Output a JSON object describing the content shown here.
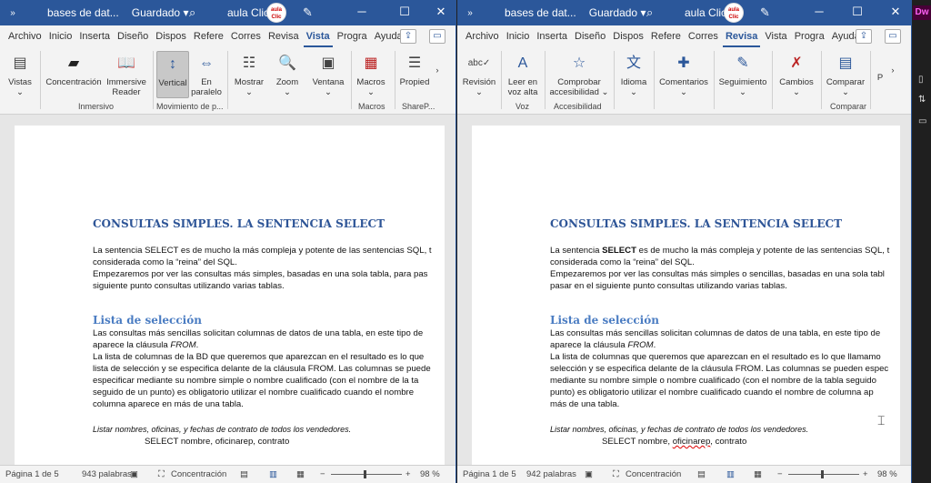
{
  "windows": [
    {
      "title": {
        "doc": "bases de dat...",
        "status": "Guardado ▾",
        "user": "aula Clic",
        "logo": "aula Clic"
      },
      "tabs": [
        "Archivo",
        "Inicio",
        "Inserta",
        "Diseño",
        "Dispos",
        "Refere",
        "Corres",
        "Revisa",
        "Vista",
        "Progra",
        "Ayuda"
      ],
      "active_tab": "Vista",
      "ribbon": {
        "buttons": [
          "Vistas",
          "Concentración",
          "Immersive Reader",
          "Vertical",
          "En paralelo",
          "Mostrar",
          "Zoom",
          "Ventana",
          "Macros",
          "Propied"
        ],
        "groups": [
          "Inmersivo",
          "Movimiento de p...",
          "Macros",
          "ShareP..."
        ]
      },
      "doc": {
        "heading": "CONSULTAS SIMPLES. LA SENTENCIA SELECT",
        "p1_line1": "La sentencia SELECT es de mucho la más compleja y potente de las sentencias SQL, t",
        "p1_line2": "considerada como la “reina” del SQL.",
        "p2_line1": "Empezaremos por ver las consultas más simples, basadas en una sola tabla, para pas",
        "p2_line2": "siguiente punto consultas utilizando varias tablas.",
        "subheading": "Lista de selección",
        "p3_line1": "Las consultas más sencillas solicitan columnas de datos de una tabla, en este tipo de",
        "p3_line2a": "aparece la cláusula ",
        "p3_line2b": "FROM",
        "p3_line2c": ".",
        "p4_line1": "La lista de columnas de la BD que queremos que aparezcan en el resultado es lo que",
        "p4_line2": "lista de selección y se especifica delante de la cláusula FROM. Las columnas se puede",
        "p4_line3": "especificar mediante su nombre simple o nombre cualificado (con el nombre de la ta",
        "p4_line4": "seguido de un punto) es obligatorio utilizar el nombre cualificado cuando el nombre",
        "p4_line5": "columna aparece en más de una tabla.",
        "example": "Listar nombres, oficinas, y fechas de contrato de todos los vendedores.",
        "sql_a": "SELECT nombre, ",
        "sql_b": "oficinarep",
        "sql_c": ", contrato"
      },
      "status": {
        "page": "Página 1 de 5",
        "words": "943 palabras",
        "focus": "Concentración",
        "zoom": "98 %"
      }
    },
    {
      "title": {
        "doc": "bases de dat...",
        "status": "Guardado ▾",
        "user": "aula Clic",
        "logo": "aula Clic"
      },
      "tabs": [
        "Archivo",
        "Inicio",
        "Inserta",
        "Diseño",
        "Dispos",
        "Refere",
        "Corres",
        "Revisa",
        "Vista",
        "Progra",
        "Ayuda"
      ],
      "active_tab": "Revisa",
      "ribbon": {
        "buttons": [
          "Revisión",
          "Leer en voz alta",
          "Comprobar accesibilidad",
          "Idioma",
          "Comentarios",
          "Seguimiento",
          "Cambios",
          "Comparar",
          "P"
        ],
        "groups": [
          "Voz",
          "Accesibilidad",
          "Comparar"
        ]
      },
      "doc": {
        "heading": "CONSULTAS SIMPLES. LA SENTENCIA SELECT",
        "p1_line1a": "La sentencia ",
        "p1_line1b": "SELECT",
        "p1_line1c": " es de mucho la más compleja y potente de las sentencias SQL, t",
        "p1_line2": "considerada como la “reina” del SQL.",
        "p2_line1": "Empezaremos por ver las consultas más simples o sencillas, basadas en una sola tabl",
        "p2_line2": "pasar en el siguiente punto consultas utilizando varias tablas.",
        "subheading": "Lista de selección",
        "p3_line1": "Las consultas más sencillas solicitan columnas de datos de una tabla, en este tipo de",
        "p3_line2a": "aparece la cláusula ",
        "p3_line2b": "FROM",
        "p3_line2c": ".",
        "p4_line1": "La lista de columnas que queremos que aparezcan en el resultado es lo que llamamo",
        "p4_line2": "selección y se especifica delante de la cláusula FROM. Las columnas se pueden espec",
        "p4_line3": "mediante su nombre simple o nombre cualificado (con el nombre de la tabla seguido",
        "p4_line4": "punto) es obligatorio utilizar el nombre cualificado cuando el nombre de columna ap",
        "p4_line5": "más de una tabla.",
        "example": "Listar nombres, oficinas, y fechas de contrato de todos los vendedores.",
        "sql_a": "SELECT nombre, ",
        "sql_b": "oficinarep",
        "sql_c": ", contrato"
      },
      "status": {
        "page": "Página 1 de 5",
        "words": "942 palabras",
        "focus": "Concentración",
        "zoom": "98 %"
      }
    }
  ],
  "sidebar": {
    "app_badge": "Dw"
  },
  "colors": {
    "word_blue": "#2b579a",
    "heading_blue": "#2e5597",
    "subheading_blue": "#4a7cc2"
  }
}
